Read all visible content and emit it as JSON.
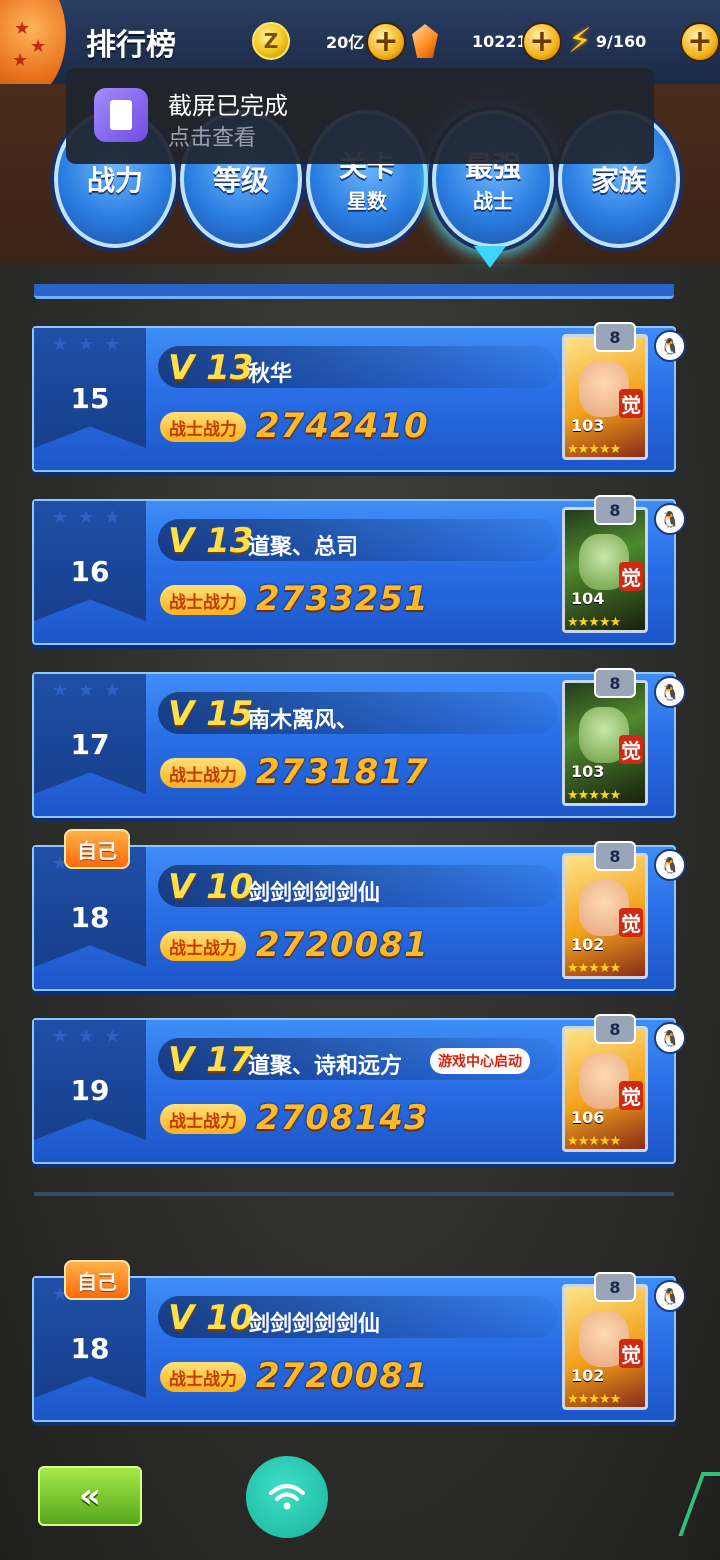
{
  "header": {
    "title": "排行榜",
    "gold": "20亿",
    "gems": "10221",
    "stamina": "9/160",
    "coin_glyph": "Z",
    "plus_glyph": "+",
    "bolt_glyph": "⚡"
  },
  "tabs": [
    {
      "label": "战力",
      "sub": ""
    },
    {
      "label": "等级",
      "sub": ""
    },
    {
      "label": "关卡",
      "sub": "星数"
    },
    {
      "label": "最强",
      "sub": "战士",
      "active": true
    },
    {
      "label": "家族",
      "sub": ""
    }
  ],
  "toast": {
    "title": "截屏已完成",
    "subtitle": "点击查看"
  },
  "power_label": "战士战力",
  "self_label": "自己",
  "rows": [
    {
      "rank": "15",
      "vip": "V 13",
      "name": "秋华",
      "power": "2742410",
      "level": "103",
      "badge": "8",
      "portrait": "saiyan"
    },
    {
      "rank": "16",
      "vip": "V 13",
      "name": "道聚、总司",
      "power": "2733251",
      "level": "104",
      "badge": "8",
      "portrait": "cell"
    },
    {
      "rank": "17",
      "vip": "V 15",
      "name": "南木离风、",
      "power": "2731817",
      "level": "103",
      "badge": "8",
      "portrait": "cell"
    },
    {
      "rank": "18",
      "vip": "V 10",
      "name": "剑剑剑剑剑仙",
      "power": "2720081",
      "level": "102",
      "badge": "8",
      "portrait": "saiyan",
      "self": true
    },
    {
      "rank": "19",
      "vip": "V 17",
      "name": "道聚、诗和远方",
      "power": "2708143",
      "level": "106",
      "badge": "8",
      "portrait": "saiyan",
      "game_center": "游戏中心启动"
    }
  ],
  "my_row": {
    "rank": "18",
    "vip": "V 10",
    "name": "剑剑剑剑剑仙",
    "power": "2720081",
    "level": "102",
    "badge": "8"
  },
  "awake_label": "觉",
  "star_glyphs": "★★★★★",
  "rank_stars": "★★★",
  "back_label": "«"
}
